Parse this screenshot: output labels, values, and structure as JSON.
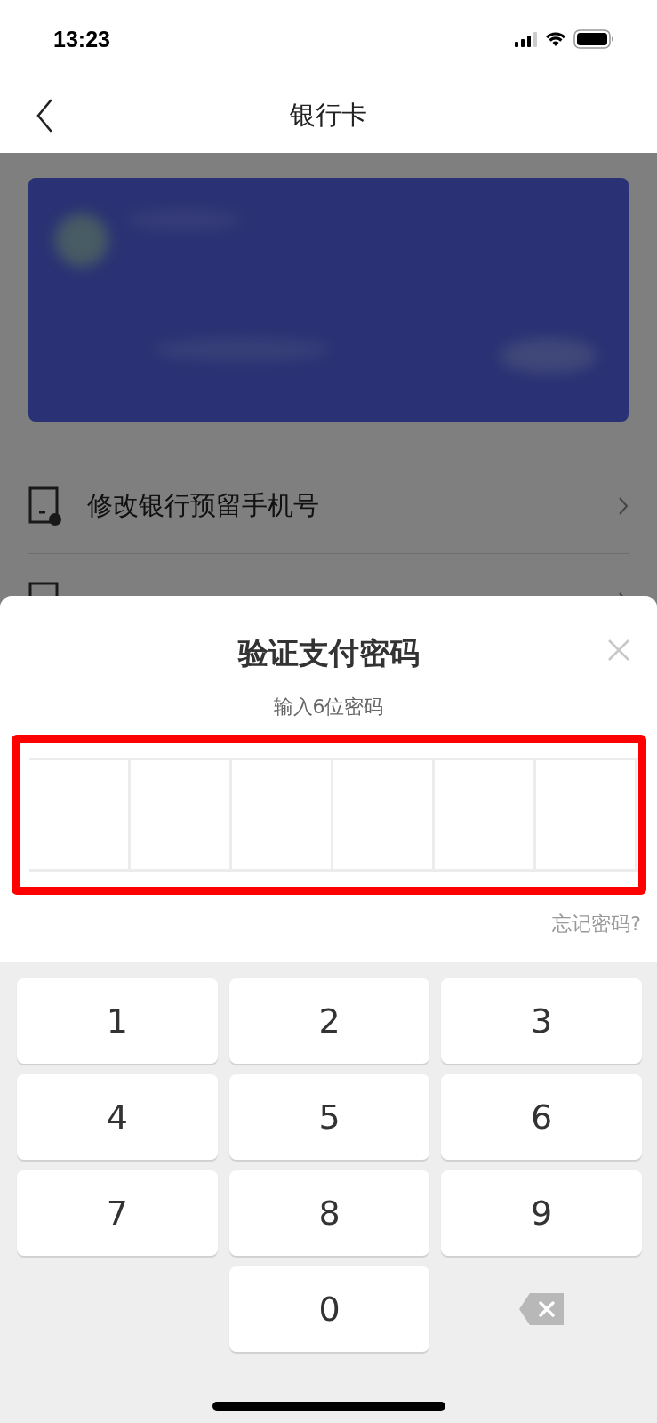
{
  "status_bar": {
    "time": "13:23"
  },
  "nav": {
    "title": "银行卡"
  },
  "menu": [
    {
      "label": "修改银行预留手机号"
    }
  ],
  "dialog": {
    "title": "验证支付密码",
    "subtitle": "输入6位密码",
    "pin_cells": [
      {
        "filled": false
      },
      {
        "filled": false
      },
      {
        "filled": false
      },
      {
        "filled": false
      },
      {
        "filled": false
      },
      {
        "filled": false
      }
    ],
    "forgot_link": "忘记密码?"
  },
  "keypad": [
    {
      "kind": "digit",
      "label": "1"
    },
    {
      "kind": "digit",
      "label": "2"
    },
    {
      "kind": "digit",
      "label": "3"
    },
    {
      "kind": "digit",
      "label": "4"
    },
    {
      "kind": "digit",
      "label": "5"
    },
    {
      "kind": "digit",
      "label": "6"
    },
    {
      "kind": "digit",
      "label": "7"
    },
    {
      "kind": "digit",
      "label": "8"
    },
    {
      "kind": "digit",
      "label": "9"
    },
    {
      "kind": "blank"
    },
    {
      "kind": "digit",
      "label": "0"
    },
    {
      "kind": "delete"
    }
  ]
}
